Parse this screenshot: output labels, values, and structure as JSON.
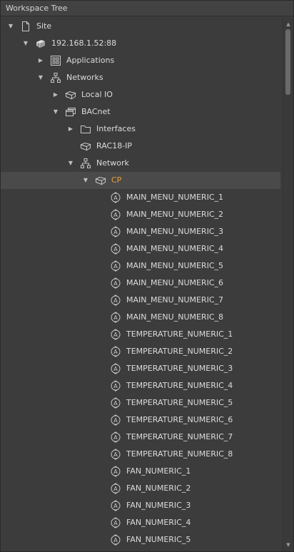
{
  "panel": {
    "title": "Workspace Tree"
  },
  "tree": {
    "nodes": [
      {
        "label": "Site",
        "depth": 0,
        "expanded": true,
        "icon": "document-icon",
        "selected": false
      },
      {
        "label": "192.168.1.52:88",
        "depth": 1,
        "expanded": true,
        "icon": "device-stack-icon",
        "selected": false
      },
      {
        "label": "Applications",
        "depth": 2,
        "expanded": false,
        "icon": "applications-icon",
        "selected": false
      },
      {
        "label": "Networks",
        "depth": 2,
        "expanded": true,
        "icon": "network-icon",
        "selected": false
      },
      {
        "label": "Local IO",
        "depth": 3,
        "expanded": false,
        "icon": "box-icon",
        "selected": false
      },
      {
        "label": "BACnet",
        "depth": 3,
        "expanded": true,
        "icon": "window-stack-icon",
        "selected": false
      },
      {
        "label": "Interfaces",
        "depth": 4,
        "expanded": false,
        "icon": "folder-icon",
        "selected": false
      },
      {
        "label": "RAC18-IP",
        "depth": 4,
        "expanded": null,
        "icon": "box-icon",
        "selected": false
      },
      {
        "label": "Network",
        "depth": 4,
        "expanded": true,
        "icon": "network-icon",
        "selected": false
      },
      {
        "label": "CP",
        "depth": 5,
        "expanded": true,
        "icon": "box-icon",
        "selected": true
      },
      {
        "label": "MAIN_MENU_NUMERIC_1",
        "depth": 6,
        "expanded": null,
        "icon": "analog-value-icon",
        "selected": false
      },
      {
        "label": "MAIN_MENU_NUMERIC_2",
        "depth": 6,
        "expanded": null,
        "icon": "analog-value-icon",
        "selected": false
      },
      {
        "label": "MAIN_MENU_NUMERIC_3",
        "depth": 6,
        "expanded": null,
        "icon": "analog-value-icon",
        "selected": false
      },
      {
        "label": "MAIN_MENU_NUMERIC_4",
        "depth": 6,
        "expanded": null,
        "icon": "analog-value-icon",
        "selected": false
      },
      {
        "label": "MAIN_MENU_NUMERIC_5",
        "depth": 6,
        "expanded": null,
        "icon": "analog-value-icon",
        "selected": false
      },
      {
        "label": "MAIN_MENU_NUMERIC_6",
        "depth": 6,
        "expanded": null,
        "icon": "analog-value-icon",
        "selected": false
      },
      {
        "label": "MAIN_MENU_NUMERIC_7",
        "depth": 6,
        "expanded": null,
        "icon": "analog-value-icon",
        "selected": false
      },
      {
        "label": "MAIN_MENU_NUMERIC_8",
        "depth": 6,
        "expanded": null,
        "icon": "analog-value-icon",
        "selected": false
      },
      {
        "label": "TEMPERATURE_NUMERIC_1",
        "depth": 6,
        "expanded": null,
        "icon": "analog-value-icon",
        "selected": false
      },
      {
        "label": "TEMPERATURE_NUMERIC_2",
        "depth": 6,
        "expanded": null,
        "icon": "analog-value-icon",
        "selected": false
      },
      {
        "label": "TEMPERATURE_NUMERIC_3",
        "depth": 6,
        "expanded": null,
        "icon": "analog-value-icon",
        "selected": false
      },
      {
        "label": "TEMPERATURE_NUMERIC_4",
        "depth": 6,
        "expanded": null,
        "icon": "analog-value-icon",
        "selected": false
      },
      {
        "label": "TEMPERATURE_NUMERIC_5",
        "depth": 6,
        "expanded": null,
        "icon": "analog-value-icon",
        "selected": false
      },
      {
        "label": "TEMPERATURE_NUMERIC_6",
        "depth": 6,
        "expanded": null,
        "icon": "analog-value-icon",
        "selected": false
      },
      {
        "label": "TEMPERATURE_NUMERIC_7",
        "depth": 6,
        "expanded": null,
        "icon": "analog-value-icon",
        "selected": false
      },
      {
        "label": "TEMPERATURE_NUMERIC_8",
        "depth": 6,
        "expanded": null,
        "icon": "analog-value-icon",
        "selected": false
      },
      {
        "label": "FAN_NUMERIC_1",
        "depth": 6,
        "expanded": null,
        "icon": "analog-value-icon",
        "selected": false
      },
      {
        "label": "FAN_NUMERIC_2",
        "depth": 6,
        "expanded": null,
        "icon": "analog-value-icon",
        "selected": false
      },
      {
        "label": "FAN_NUMERIC_3",
        "depth": 6,
        "expanded": null,
        "icon": "analog-value-icon",
        "selected": false
      },
      {
        "label": "FAN_NUMERIC_4",
        "depth": 6,
        "expanded": null,
        "icon": "analog-value-icon",
        "selected": false
      },
      {
        "label": "FAN_NUMERIC_5",
        "depth": 6,
        "expanded": null,
        "icon": "analog-value-icon",
        "selected": false
      }
    ]
  },
  "colors": {
    "background": "#3c3c3c",
    "selected_row": "#4a4a4a",
    "selected_text": "#e8a23a",
    "text": "#dcdcdc"
  }
}
